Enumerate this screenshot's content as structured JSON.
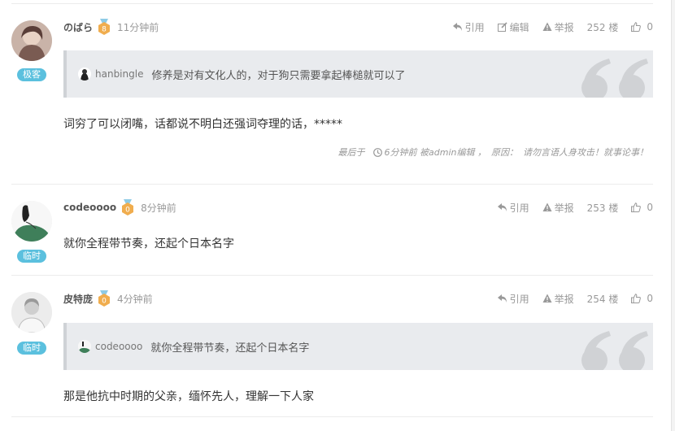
{
  "colors": {
    "role_badge": "#5bc0de",
    "level_badge": "#f0ad4e",
    "quote_bg": "#e9ebee"
  },
  "labels": {
    "quote": "引用",
    "edit": "编辑",
    "report": "举报"
  },
  "comments": [
    {
      "user": "のばら",
      "level": "8",
      "time": "11分钟前",
      "role": "极客",
      "floor": "252 楼",
      "likes": "0",
      "quote": {
        "user": "hanbingle",
        "text": "修养是对有文化人的，对于狗只需要拿起棒槌就可以了"
      },
      "text": "词穷了可以闭嘴，话都说不明白还强词夺理的话，*****",
      "edit_note": {
        "prefix": "最后于",
        "time": "6分钟前 被admin编辑 ，",
        "reason_label": "原因：",
        "reason": "请勿言语人身攻击！就事论事！"
      }
    },
    {
      "user": "codeoooo",
      "level": "0",
      "time": "8分钟前",
      "role": "临时",
      "floor": "253 楼",
      "likes": "0",
      "text": "就你全程带节奏，还起个日本名字"
    },
    {
      "user": "皮特庞",
      "level": "0",
      "time": "4分钟前",
      "role": "临时",
      "floor": "254 楼",
      "likes": "0",
      "quote": {
        "user": "codeoooo",
        "text": "就你全程带节奏，还起个日本名字"
      },
      "text": "那是他抗中时期的父亲，缅怀先人，理解一下人家"
    }
  ]
}
